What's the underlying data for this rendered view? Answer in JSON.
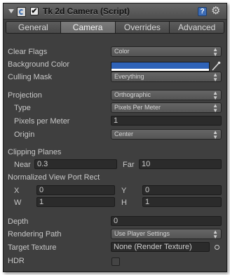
{
  "header": {
    "title": "Tk 2d Camera (Script)",
    "enabled_mark": "✔",
    "help_mark": "?",
    "gear_mark": "⚙",
    "icons": [
      "foldout-arrow-icon",
      "script-icon",
      "enabled-checkbox",
      "help-icon",
      "gear-icon"
    ]
  },
  "tabs": [
    {
      "label": "General",
      "active": false
    },
    {
      "label": "Camera",
      "active": true
    },
    {
      "label": "Overrides",
      "active": false
    },
    {
      "label": "Advanced",
      "active": false
    }
  ],
  "fields": {
    "clear_flags": {
      "label": "Clear Flags",
      "value": "Color"
    },
    "background_color": {
      "label": "Background Color",
      "color": "#2f63b8"
    },
    "culling_mask": {
      "label": "Culling Mask",
      "value": "Everything"
    },
    "projection": {
      "label": "Projection",
      "value": "Orthographic"
    },
    "type": {
      "label": "Type",
      "value": "Pixels Per Meter"
    },
    "pixels_per_meter": {
      "label": "Pixels per Meter",
      "value": "1"
    },
    "origin": {
      "label": "Origin",
      "value": "Center"
    },
    "clipping_planes": {
      "label": "Clipping Planes",
      "near_label": "Near",
      "near_value": "0.3",
      "far_label": "Far",
      "far_value": "10"
    },
    "viewport_rect": {
      "label": "Normalized View Port Rect",
      "x_label": "X",
      "x_value": "0",
      "y_label": "Y",
      "y_value": "0",
      "w_label": "W",
      "w_value": "1",
      "h_label": "H",
      "h_value": "1"
    },
    "depth": {
      "label": "Depth",
      "value": "0"
    },
    "rendering_path": {
      "label": "Rendering Path",
      "value": "Use Player Settings"
    },
    "target_texture": {
      "label": "Target Texture",
      "value": "None (Render Texture)"
    },
    "hdr": {
      "label": "HDR",
      "checked": false
    }
  },
  "dropdown_arrows": {
    "up": "▲",
    "down": "▼"
  },
  "colors": {
    "panel_bg": "#3f3f3f",
    "accent_blue": "#2f63b8",
    "text": "#c8c8c8"
  }
}
